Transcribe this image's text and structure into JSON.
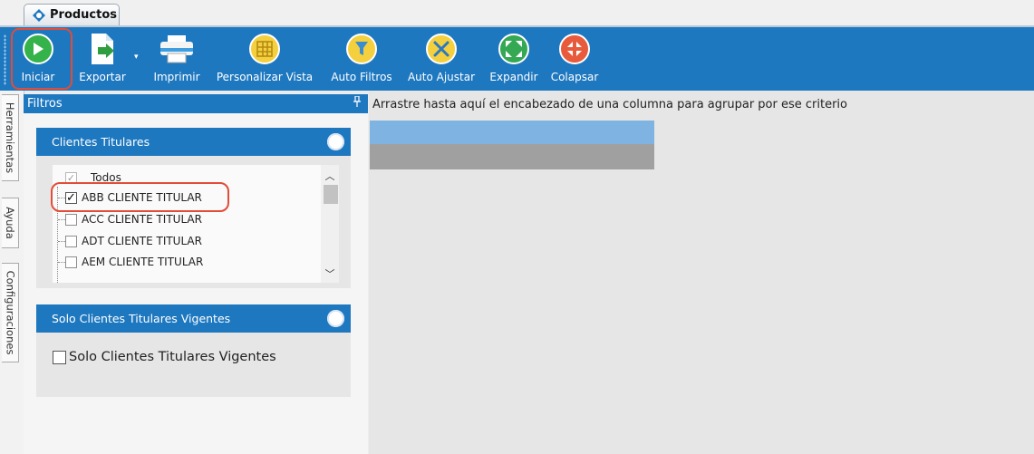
{
  "tab": {
    "title": "Productos"
  },
  "toolbar": {
    "buttons": [
      {
        "label": "Iniciar",
        "icon": "play-icon"
      },
      {
        "label": "Exportar",
        "icon": "export-icon"
      },
      {
        "label": "Imprimir",
        "icon": "printer-icon"
      },
      {
        "label": "Personalizar Vista",
        "icon": "grid-layout-icon"
      },
      {
        "label": "Auto Filtros",
        "icon": "filter-icon"
      },
      {
        "label": "Auto Ajustar",
        "icon": "tools-icon"
      },
      {
        "label": "Expandir",
        "icon": "expand-icon"
      },
      {
        "label": "Colapsar",
        "icon": "collapse-icon"
      }
    ],
    "colors": {
      "background": "#1e78c0",
      "highlight": "#e24c38"
    }
  },
  "side_tabs": [
    "Herramientas",
    "Ayuda",
    "Configuraciones"
  ],
  "filters_panel": {
    "title": "Filtros",
    "group1": {
      "title": "Clientes Titulares",
      "items": [
        {
          "label": "Todos",
          "checked": true
        },
        {
          "label": "ABB CLIENTE TITULAR",
          "checked": true
        },
        {
          "label": "ACC CLIENTE TITULAR",
          "checked": false
        },
        {
          "label": "ADT CLIENTE TITULAR",
          "checked": false
        },
        {
          "label": "AEM CLIENTE TITULAR",
          "checked": false
        }
      ]
    },
    "group2": {
      "title": "Solo Clientes Titulares Vigentes",
      "checkbox_label": "Solo Clientes Titulares Vigentes",
      "checked": false
    }
  },
  "grid": {
    "group_hint": "Arrastre hasta aquí el encabezado de una columna para agrupar por ese criterio"
  }
}
